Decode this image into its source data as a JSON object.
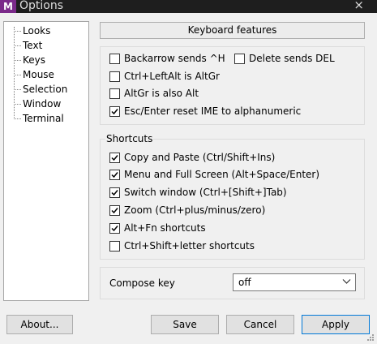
{
  "window": {
    "app_icon": "M",
    "title": "Options",
    "close_glyph": "×"
  },
  "sidebar": {
    "items": [
      {
        "label": "Looks"
      },
      {
        "label": "Text"
      },
      {
        "label": "Keys"
      },
      {
        "label": "Mouse"
      },
      {
        "label": "Selection"
      },
      {
        "label": "Window"
      },
      {
        "label": "Terminal"
      }
    ]
  },
  "panel": {
    "header": "Keyboard features"
  },
  "options": {
    "backarrow": {
      "label": "Backarrow sends ^H",
      "checked": false
    },
    "delete_del": {
      "label": "Delete sends DEL",
      "checked": false
    },
    "ctrl_leftalt": {
      "label": "Ctrl+LeftAlt is AltGr",
      "checked": false
    },
    "altgr_alt": {
      "label": "AltGr is also Alt",
      "checked": false
    },
    "esc_enter": {
      "label": "Esc/Enter reset IME to alphanumeric",
      "checked": true
    }
  },
  "shortcuts": {
    "title": "Shortcuts",
    "copy_paste": {
      "label": "Copy and Paste (Ctrl/Shift+Ins)",
      "checked": true
    },
    "menu_full": {
      "label": "Menu and Full Screen (Alt+Space/Enter)",
      "checked": true
    },
    "switch_window": {
      "label": "Switch window (Ctrl+[Shift+]Tab)",
      "checked": true
    },
    "zoom": {
      "label": "Zoom (Ctrl+plus/minus/zero)",
      "checked": true
    },
    "altfn": {
      "label": "Alt+Fn shortcuts",
      "checked": true
    },
    "ctrl_shift_letter": {
      "label": "Ctrl+Shift+letter shortcuts",
      "checked": false
    }
  },
  "compose": {
    "label": "Compose key",
    "value": "off"
  },
  "buttons": {
    "about": "About...",
    "save": "Save",
    "cancel": "Cancel",
    "apply": "Apply"
  },
  "colors": {
    "titlebar": "#1e1e1e",
    "app_icon": "#7b2a8a",
    "apply_border": "#0078d7"
  }
}
